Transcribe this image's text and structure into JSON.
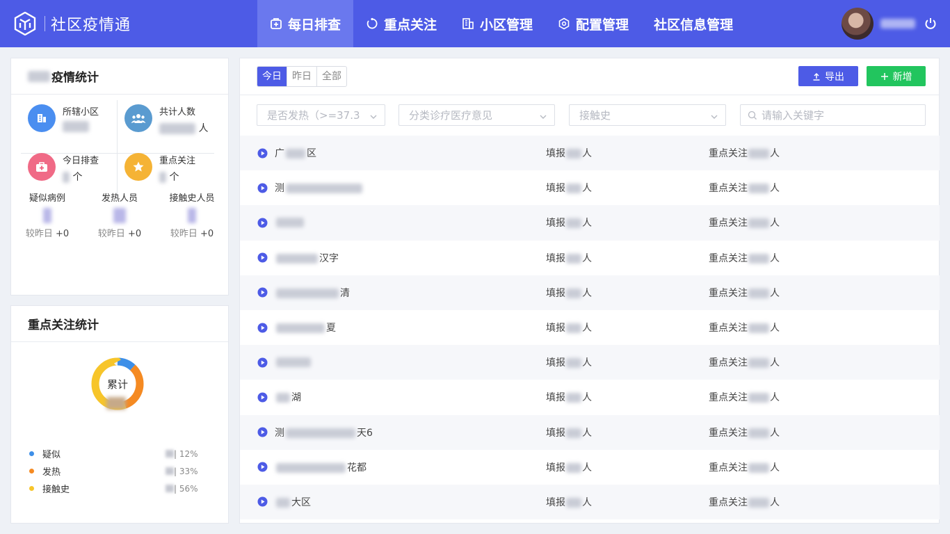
{
  "app": {
    "title": "社区疫情通",
    "user_name": ""
  },
  "nav": [
    {
      "label": "每日排查",
      "icon": "plus-square-icon",
      "active": true
    },
    {
      "label": "重点关注",
      "icon": "refresh-circle-icon",
      "active": false
    },
    {
      "label": "小区管理",
      "icon": "building-icon",
      "active": false
    },
    {
      "label": "配置管理",
      "icon": "settings-hex-icon",
      "active": false
    },
    {
      "label": "社区信息管理",
      "icon": "",
      "active": false
    }
  ],
  "epidemic_stats": {
    "title": "疫情统计",
    "cells": [
      {
        "label": "所辖小区",
        "value": "",
        "unit": "",
        "icon": "building-icon",
        "color": "#4a8ef0"
      },
      {
        "label": "共计人数",
        "value": "",
        "unit": "人",
        "icon": "group-icon",
        "color": "#5a9bd0"
      },
      {
        "label": "今日排查",
        "value": "",
        "unit": "个",
        "icon": "medkit-icon",
        "color": "#f06a86"
      },
      {
        "label": "重点关注",
        "value": "",
        "unit": "个",
        "icon": "star-icon",
        "color": "#f5b335"
      }
    ],
    "minis": [
      {
        "label": "疑似病例",
        "compare_label": "较昨日",
        "compare_value": "+0"
      },
      {
        "label": "发热人员",
        "compare_label": "较昨日",
        "compare_value": "+0"
      },
      {
        "label": "接触史人员",
        "compare_label": "较昨日",
        "compare_value": "+0"
      }
    ]
  },
  "focus_stats": {
    "title": "重点关注统计",
    "donut_label": "累计",
    "segments": [
      {
        "name": "疑似",
        "percent": 12,
        "pct_text": "| 12%",
        "color": "#3d8fe8"
      },
      {
        "name": "发热",
        "percent": 33,
        "pct_text": "| 33%",
        "color": "#f58a22"
      },
      {
        "name": "接触史",
        "percent": 56,
        "pct_text": "| 56%",
        "color": "#f7c52a"
      }
    ]
  },
  "toolbar": {
    "tabs": [
      "今日",
      "昨日",
      "全部"
    ],
    "export_label": "导出",
    "add_label": "新增",
    "export_color": "#4d5be6",
    "add_color": "#22c55e"
  },
  "filters": {
    "fever_placeholder": "是否发热（>=37.3",
    "medical_placeholder": "分类诊疗医疗意见",
    "contact_placeholder": "接触史",
    "search_placeholder": "请输入关键字"
  },
  "rows": [
    {
      "name_visible": "广",
      "name_tail": "区",
      "reporter_label": "填报",
      "reporter_tail": "人",
      "focus_label": "重点关注",
      "focus_tail": "人"
    },
    {
      "name_visible": "测",
      "name_tail": "",
      "reporter_label": "填报",
      "reporter_tail": "人",
      "focus_label": "重点关注",
      "focus_tail": "人"
    },
    {
      "name_visible": "",
      "name_tail": "",
      "reporter_label": "填报",
      "reporter_tail": "人",
      "focus_label": "重点关注",
      "focus_tail": "人"
    },
    {
      "name_visible": "",
      "name_tail": "汉字",
      "reporter_label": "填报",
      "reporter_tail": "人",
      "focus_label": "重点关注",
      "focus_tail": "人"
    },
    {
      "name_visible": "",
      "name_tail": "清",
      "reporter_label": "填报",
      "reporter_tail": "人",
      "focus_label": "重点关注",
      "focus_tail": "人"
    },
    {
      "name_visible": "",
      "name_tail": "夏",
      "reporter_label": "填报",
      "reporter_tail": "人",
      "focus_label": "重点关注",
      "focus_tail": "人"
    },
    {
      "name_visible": "",
      "name_tail": "",
      "reporter_label": "填报",
      "reporter_tail": "人",
      "focus_label": "重点关注",
      "focus_tail": "人"
    },
    {
      "name_visible": "",
      "name_tail": "湖",
      "reporter_label": "填报",
      "reporter_tail": "人",
      "focus_label": "重点关注",
      "focus_tail": "人"
    },
    {
      "name_visible": "测",
      "name_tail": "天6",
      "reporter_label": "填报",
      "reporter_tail": "人",
      "focus_label": "重点关注",
      "focus_tail": "人"
    },
    {
      "name_visible": "",
      "name_tail": "花都",
      "reporter_label": "填报",
      "reporter_tail": "人",
      "focus_label": "重点关注",
      "focus_tail": "人"
    },
    {
      "name_visible": "",
      "name_tail": "大区",
      "reporter_label": "填报",
      "reporter_tail": "人",
      "focus_label": "重点关注",
      "focus_tail": "人"
    }
  ]
}
